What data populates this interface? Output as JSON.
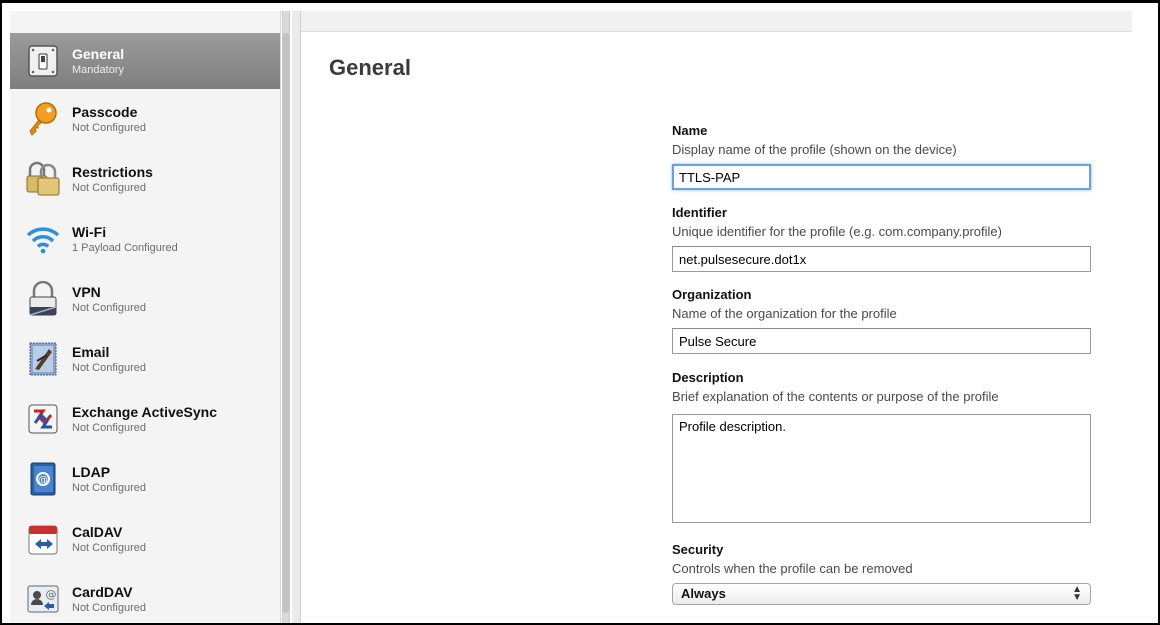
{
  "sidebar": {
    "items": [
      {
        "title": "General",
        "subtitle": "Mandatory",
        "icon": "switch-icon"
      },
      {
        "title": "Passcode",
        "subtitle": "Not Configured",
        "icon": "key-icon"
      },
      {
        "title": "Restrictions",
        "subtitle": "Not Configured",
        "icon": "padlocks-icon"
      },
      {
        "title": "Wi-Fi",
        "subtitle": "1 Payload Configured",
        "icon": "wifi-icon"
      },
      {
        "title": "VPN",
        "subtitle": "Not Configured",
        "icon": "vpn-lock-icon"
      },
      {
        "title": "Email",
        "subtitle": "Not Configured",
        "icon": "email-stamp-icon"
      },
      {
        "title": "Exchange ActiveSync",
        "subtitle": "Not Configured",
        "icon": "exchange-icon"
      },
      {
        "title": "LDAP",
        "subtitle": "Not Configured",
        "icon": "ldap-book-icon"
      },
      {
        "title": "CalDAV",
        "subtitle": "Not Configured",
        "icon": "calendar-icon"
      },
      {
        "title": "CardDAV",
        "subtitle": "Not Configured",
        "icon": "contacts-icon"
      }
    ]
  },
  "main": {
    "title": "General",
    "name": {
      "label": "Name",
      "description": "Display name of the profile (shown on the device)",
      "value": "TTLS-PAP"
    },
    "identifier": {
      "label": "Identifier",
      "description": "Unique identifier for the profile (e.g. com.company.profile)",
      "value": "net.pulsesecure.dot1x"
    },
    "organization": {
      "label": "Organization",
      "description": "Name of the organization for the profile",
      "value": "Pulse Secure"
    },
    "description": {
      "label": "Description",
      "description": "Brief explanation of the contents or purpose of the profile",
      "value": "Profile description."
    },
    "security": {
      "label": "Security",
      "description": "Controls when the profile can be removed",
      "value": "Always"
    }
  },
  "colors": {
    "selection": "#8a8a8a",
    "focus_ring": "#6aa1e6"
  }
}
